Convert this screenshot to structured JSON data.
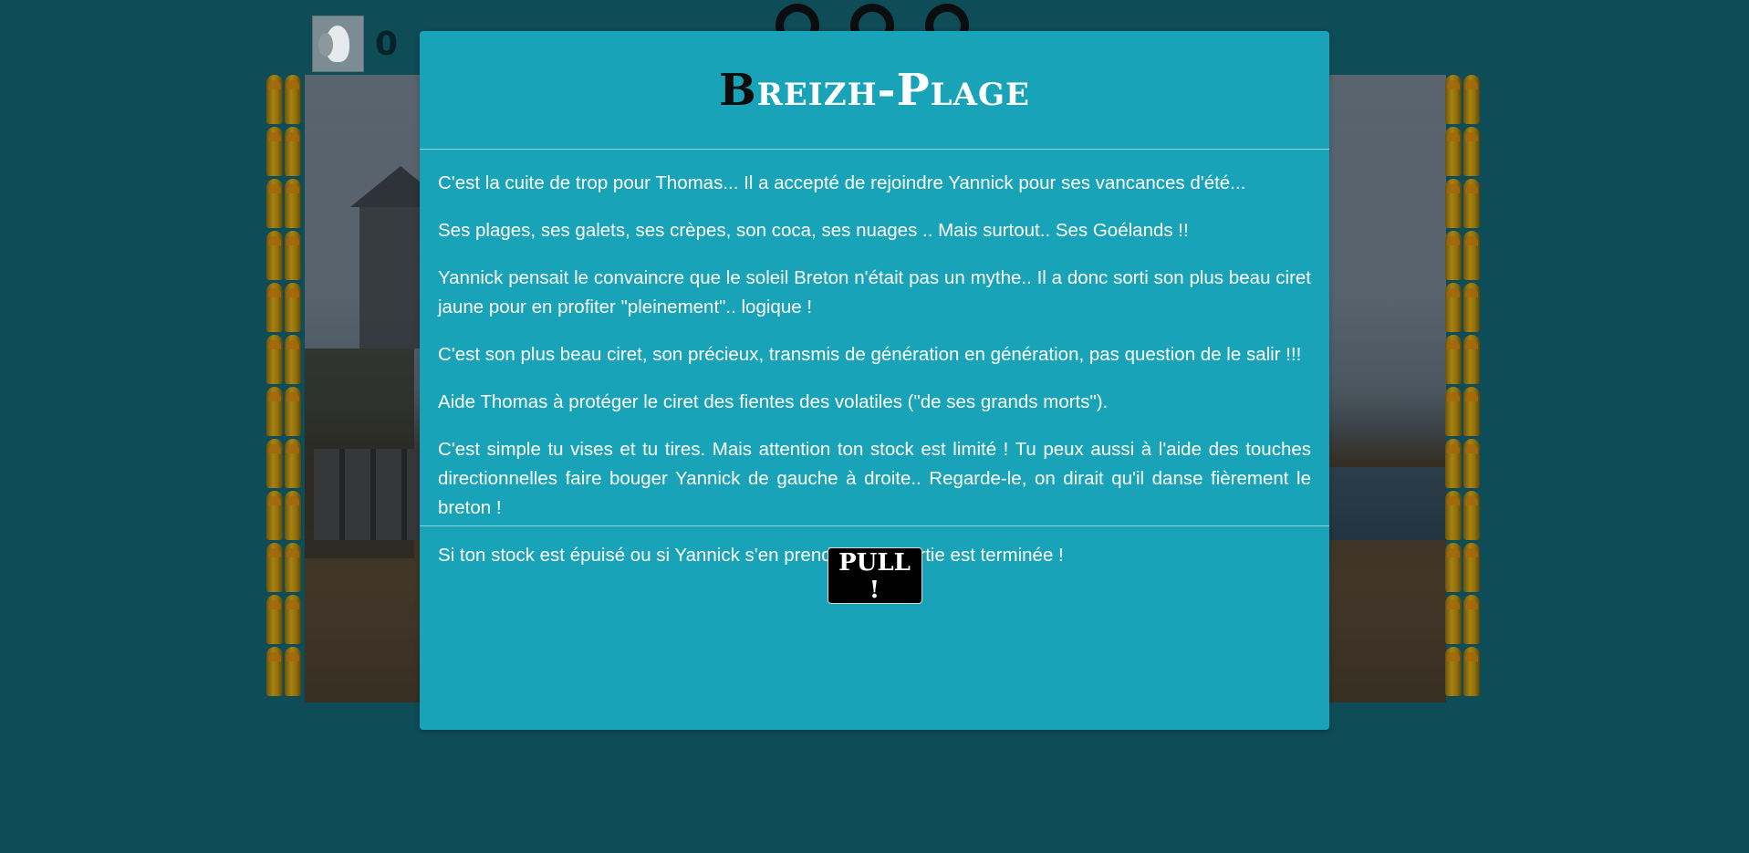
{
  "game": {
    "score": "0",
    "score_icon": "seagull-icon",
    "ammo_icon": "shell-icon"
  },
  "modal": {
    "title_first": "B",
    "title_rest": "reizh-Plage",
    "paragraphs": [
      "C'est la cuite de trop pour Thomas... Il a accepté de rejoindre Yannick pour ses vancances d'été...",
      "Ses plages, ses galets, ses crèpes, son coca, ses nuages .. Mais surtout.. Ses Goélands !!",
      "Yannick pensait le convaincre que le soleil Breton n'était pas un mythe.. Il a donc sorti son plus beau ciret jaune pour en profiter \"pleinement\".. logique !",
      "C'est son plus beau ciret, son précieux, transmis de génération en génération, pas question de le salir !!!",
      "Aide Thomas à protéger le ciret des fientes des volatiles (\"de ses grands morts\").",
      "C'est simple tu vises et tu tires. Mais attention ton stock est limité ! Tu peux aussi à l'aide des touches directionnelles faire bouger Yannick de gauche à droite.. Regarde-le, on dirait qu'il danse fièrement le breton !",
      "Si ton stock est épuisé ou si Yannick s'en prend une, la partie est terminée !"
    ],
    "button_label": "PULL !"
  },
  "colors": {
    "page_background": "#0e4c58",
    "modal_background": "#18a3b8",
    "button_background": "#000000"
  }
}
